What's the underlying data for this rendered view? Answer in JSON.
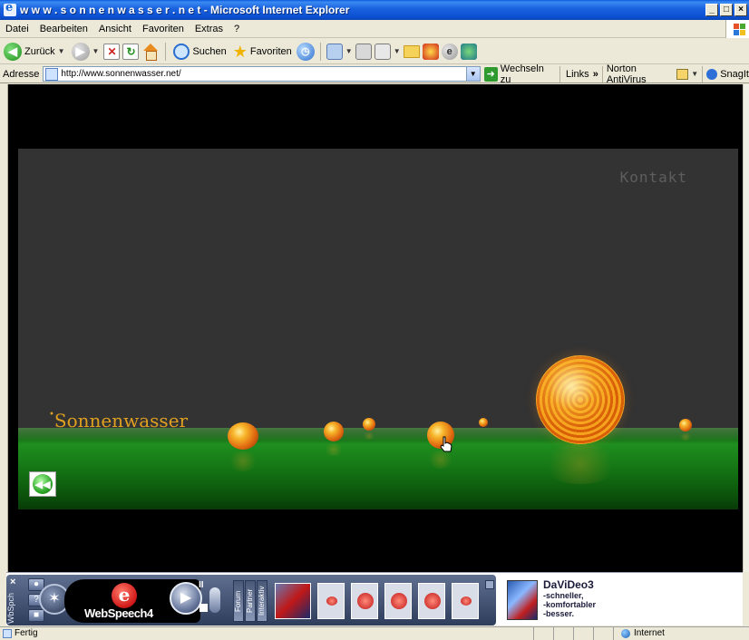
{
  "window": {
    "title": "w w w . s o n n e n w a s s e r . n e t - Microsoft Internet Explorer",
    "controls": [
      "_",
      "□",
      "×"
    ]
  },
  "menu": [
    "Datei",
    "Bearbeiten",
    "Ansicht",
    "Favoriten",
    "Extras",
    "?"
  ],
  "toolbar": {
    "back_label": "Zurück",
    "search_label": "Suchen",
    "favorites_label": "Favoriten"
  },
  "address": {
    "label": "Adresse",
    "url": "http://www.sonnenwasser.net/",
    "go_label": "Wechseln zu",
    "links_label": "Links",
    "links_more": "»",
    "norton_label": "Norton AntiVirus",
    "snagit_label": "SnagIt"
  },
  "page": {
    "contact_link": "Kontakt",
    "logo_text": "Sonnenwasser",
    "logo_mark": "•"
  },
  "webspeech": {
    "close": "×",
    "side_label": "WbSpch",
    "product_name": "WebSpeech4",
    "tabs": [
      "Forum",
      "Partner",
      "Interaktiv"
    ],
    "ad_title": "DaViDeo3",
    "ad_lines": [
      "-schneller,",
      "-komfortabler",
      "-besser."
    ]
  },
  "status": {
    "text": "Fertig",
    "zone": "Internet"
  },
  "colors": {
    "titlebar": "#0a4fd2",
    "stage": "#333333",
    "floor": "#1f8f1f",
    "sun": "#e27a12"
  }
}
